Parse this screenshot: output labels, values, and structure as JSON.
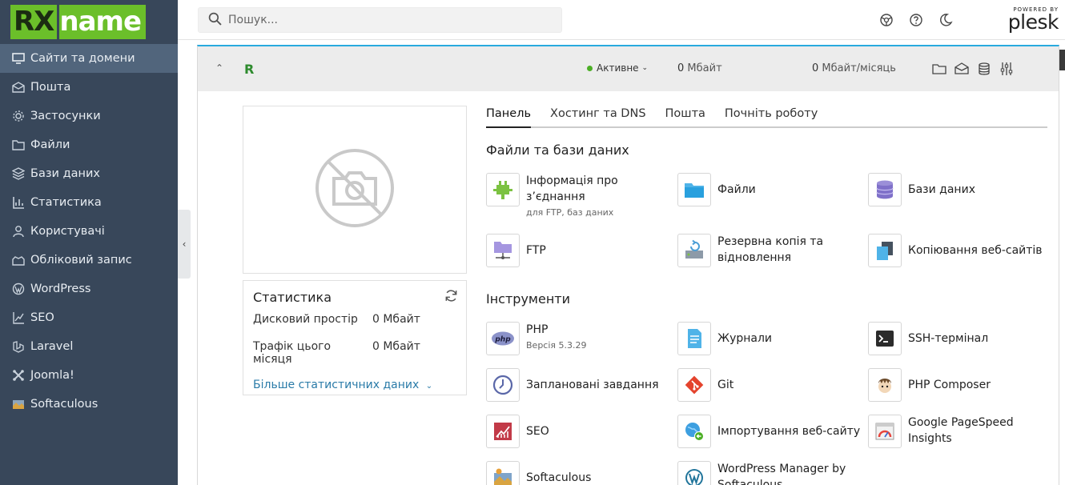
{
  "brand": {
    "logo_a": "RX",
    "logo_b": "name"
  },
  "sidebar": {
    "items": [
      {
        "label": "Сайти та домени",
        "icon": "monitor-icon"
      },
      {
        "label": "Пошта",
        "icon": "mail-icon"
      },
      {
        "label": "Застосунки",
        "icon": "gear-icon"
      },
      {
        "label": "Файли",
        "icon": "folder-icon"
      },
      {
        "label": "Бази даних",
        "icon": "database-icon"
      },
      {
        "label": "Статистика",
        "icon": "bar-chart-icon"
      },
      {
        "label": "Користувачі",
        "icon": "user-icon"
      },
      {
        "label": "Обліковий запис",
        "icon": "account-icon"
      },
      {
        "label": "WordPress",
        "icon": "wordpress-icon"
      },
      {
        "label": "SEO",
        "icon": "seo-icon"
      },
      {
        "label": "Laravel",
        "icon": "laravel-icon"
      },
      {
        "label": "Joomla!",
        "icon": "joomla-icon"
      },
      {
        "label": "Softaculous",
        "icon": "softaculous-icon"
      }
    ]
  },
  "search": {
    "placeholder": "Пошук..."
  },
  "plesk": {
    "powered_by": "POWERED BY",
    "name": "plesk"
  },
  "domain": {
    "initial": "R",
    "status": "Активне",
    "disk_value": "0",
    "disk_unit": "Мбайт",
    "traffic_value": "0",
    "traffic_unit": "Мбайт/місяць"
  },
  "stats": {
    "title": "Статистика",
    "disk_label": "Дисковий простір",
    "disk_value": "0 Мбайт",
    "traffic_label": "Трафік цього місяця",
    "traffic_value": "0 Мбайт",
    "more": "Більше статистичних даних"
  },
  "tabs": [
    "Панель",
    "Хостинг та DNS",
    "Пошта",
    "Почніть роботу"
  ],
  "sections": {
    "files_db": "Файли та бази даних",
    "tools": "Інструменти"
  },
  "tools": {
    "connection_info": {
      "label": "Інформація про з’єднання",
      "sub": "для FTP, баз даних"
    },
    "files": {
      "label": "Файли"
    },
    "databases": {
      "label": "Бази даних"
    },
    "ftp": {
      "label": "FTP"
    },
    "backup": {
      "label": "Резервна копія та відновлення"
    },
    "site_copy": {
      "label": "Копіювання веб-сайтів"
    },
    "php": {
      "label": "PHP",
      "sub": "Версія 5.3.29"
    },
    "logs": {
      "label": "Журнали"
    },
    "ssh": {
      "label": "SSH-термінал"
    },
    "scheduled": {
      "label": "Заплановані завдання"
    },
    "git": {
      "label": "Git"
    },
    "composer": {
      "label": "PHP Composer"
    },
    "seo": {
      "label": "SEO"
    },
    "import": {
      "label": "Імпортування веб-сайту"
    },
    "pagespeed": {
      "label": "Google PageSpeed Insights"
    },
    "softaculous": {
      "label": "Softaculous"
    },
    "wp_manager": {
      "label": "WordPress Manager by Softaculous"
    }
  }
}
